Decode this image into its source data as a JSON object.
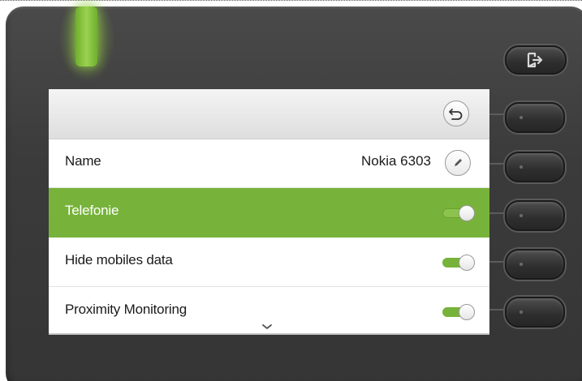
{
  "phone": {
    "led_color": "#8cc63f",
    "accent_color": "#77b33a"
  },
  "header": {
    "back_icon": "back-arrow-icon"
  },
  "rows": [
    {
      "label": "Name",
      "value": "Nokia 6303",
      "control": "edit",
      "active": false
    },
    {
      "label": "Telefonie",
      "control": "toggle",
      "on": true,
      "active": true
    },
    {
      "label": "Hide mobiles data",
      "control": "toggle",
      "on": true,
      "active": false
    },
    {
      "label": "Proximity Monitoring",
      "control": "toggle",
      "on": true,
      "active": false
    }
  ],
  "icons": {
    "exit": "exit-icon",
    "edit": "pencil-icon",
    "scroll": "chevron-down-icon"
  }
}
